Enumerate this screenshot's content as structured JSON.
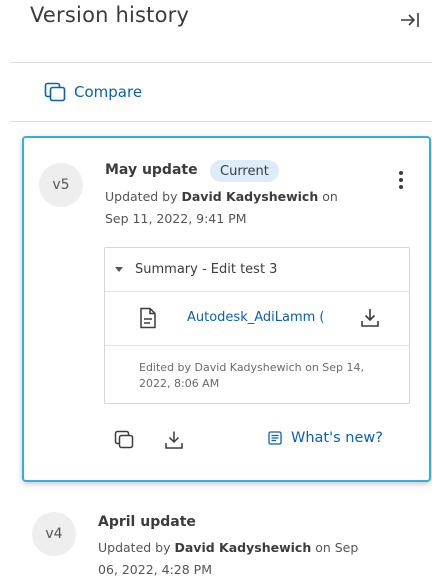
{
  "panel": {
    "title": "Version history",
    "collapse_icon": "collapse-right-icon"
  },
  "compare": {
    "label": "Compare",
    "icon": "compare-icon"
  },
  "versions": [
    {
      "badge": "v5",
      "name": "May update",
      "status": "Current",
      "updated_prefix": "Updated by",
      "author": "David Kadyshewich",
      "updated_suffix": "on",
      "date": "Sep 11, 2022, 9:41 PM",
      "summary": {
        "label": "Summary - Edit test 3",
        "file_name": "Autodesk_AdiLamm (",
        "edited_note": "Edited by David Kadyshewich on Sep 14, 2022, 8:06 AM"
      },
      "actions": {
        "whats_new_label": "What's new?"
      }
    },
    {
      "badge": "v4",
      "name": "April update",
      "updated_prefix": "Updated by",
      "author": "David Kadyshewich",
      "updated_suffix": "on Sep",
      "date": "06, 2022, 4:28 PM"
    }
  ],
  "colors": {
    "accent": "#0a5fb8",
    "selected_border": "#38abdf",
    "current_pill_bg": "#dcecfb",
    "badge_bg": "#eeeeee"
  }
}
